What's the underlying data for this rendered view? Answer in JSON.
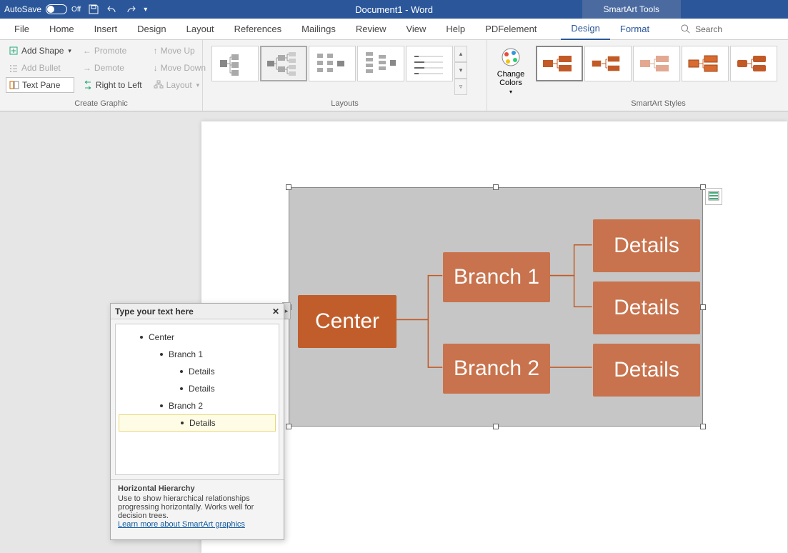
{
  "titlebar": {
    "autosave_label": "AutoSave",
    "autosave_state": "Off",
    "doc_title": "Document1  -  Word",
    "context_tool": "SmartArt Tools"
  },
  "tabs": {
    "items": [
      "File",
      "Home",
      "Insert",
      "Design",
      "Layout",
      "References",
      "Mailings",
      "Review",
      "View",
      "Help",
      "PDFelement"
    ],
    "context": [
      "Design",
      "Format"
    ],
    "active": "Design",
    "search_placeholder": "Search"
  },
  "ribbon": {
    "create_graphic": {
      "label": "Create Graphic",
      "add_shape": "Add Shape",
      "add_bullet": "Add Bullet",
      "text_pane": "Text Pane",
      "promote": "Promote",
      "demote": "Demote",
      "right_to_left": "Right to Left",
      "move_up": "Move Up",
      "move_down": "Move Down",
      "layout": "Layout"
    },
    "layouts": {
      "label": "Layouts"
    },
    "change_colors": {
      "label": "Change Colors"
    },
    "styles": {
      "label": "SmartArt Styles"
    }
  },
  "textpane": {
    "title": "Type your text here",
    "items": [
      {
        "level": 1,
        "text": "Center"
      },
      {
        "level": 2,
        "text": "Branch 1"
      },
      {
        "level": 3,
        "text": "Details"
      },
      {
        "level": 3,
        "text": "Details"
      },
      {
        "level": 2,
        "text": "Branch 2"
      },
      {
        "level": 3,
        "text": "Details",
        "selected": true
      }
    ],
    "desc_title": "Horizontal Hierarchy",
    "desc_body": "Use to show hierarchical relationships progressing horizontally. Works well for decision trees.",
    "desc_link": "Learn more about SmartArt graphics"
  },
  "smartart": {
    "nodes": {
      "center": "Center",
      "branch1": "Branch 1",
      "branch2": "Branch 2",
      "details": "Details"
    }
  },
  "colors": {
    "accent": "#c15a26",
    "accent_fade": "#c9714a"
  }
}
